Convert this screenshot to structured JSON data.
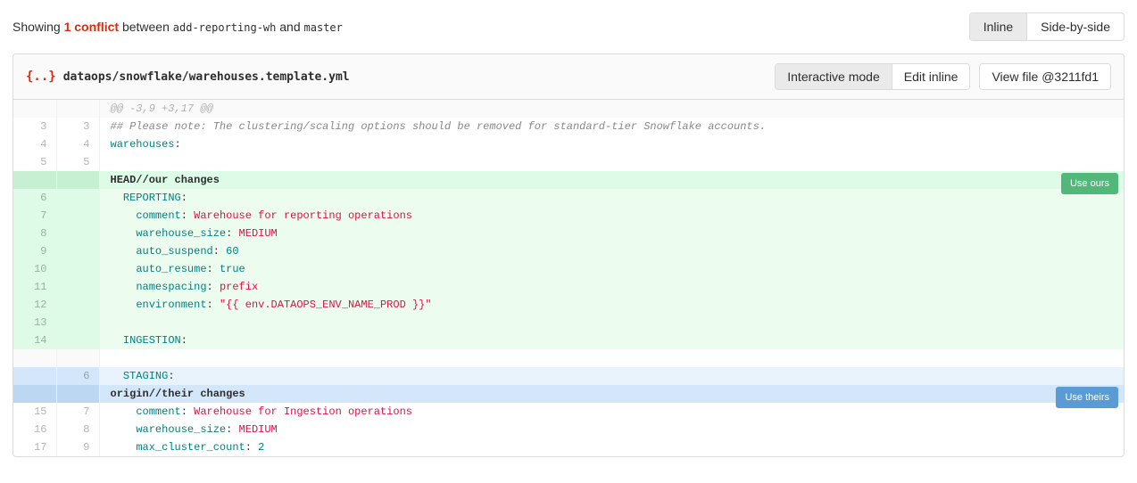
{
  "header": {
    "prefix": "Showing ",
    "conflict_count": "1 conflict",
    "between": " between ",
    "source_branch": "add-reporting-wh",
    "and": " and ",
    "target_branch": "master"
  },
  "view_toggle": {
    "inline": "Inline",
    "sidebyside": "Side-by-side"
  },
  "file": {
    "icon": "{..}",
    "path": "dataops/snowflake/warehouses.template.yml",
    "actions": {
      "interactive": "Interactive mode",
      "edit_inline": "Edit inline",
      "view_file": "View file @3211fd1"
    }
  },
  "diff": {
    "hunk": "@@ -3,9 +3,17 @@",
    "rows": [
      {
        "old": "3",
        "new": "3",
        "kind": "context",
        "segments": [
          {
            "cls": "syn-comment",
            "t": "## Please note: The clustering/scaling options should be removed for standard-tier Snowflake accounts."
          }
        ]
      },
      {
        "old": "4",
        "new": "4",
        "kind": "context",
        "segments": [
          {
            "cls": "syn-key",
            "t": "warehouses"
          },
          {
            "cls": "",
            "t": ":"
          }
        ]
      },
      {
        "old": "5",
        "new": "5",
        "kind": "context",
        "segments": []
      },
      {
        "old": "",
        "new": "",
        "kind": "head-marker",
        "badge": "Use ours",
        "segments": [
          {
            "cls": "",
            "t": "HEAD//our changes"
          }
        ]
      },
      {
        "old": "6",
        "new": "",
        "kind": "ours",
        "indent": "  ",
        "segments": [
          {
            "cls": "syn-key",
            "t": "REPORTING"
          },
          {
            "cls": "",
            "t": ":"
          }
        ]
      },
      {
        "old": "7",
        "new": "",
        "kind": "ours",
        "indent": "    ",
        "segments": [
          {
            "cls": "syn-key",
            "t": "comment"
          },
          {
            "cls": "",
            "t": ": "
          },
          {
            "cls": "syn-string",
            "t": "Warehouse for reporting operations"
          }
        ]
      },
      {
        "old": "8",
        "new": "",
        "kind": "ours",
        "indent": "    ",
        "segments": [
          {
            "cls": "syn-key",
            "t": "warehouse_size"
          },
          {
            "cls": "",
            "t": ": "
          },
          {
            "cls": "syn-string",
            "t": "MEDIUM"
          }
        ]
      },
      {
        "old": "9",
        "new": "",
        "kind": "ours",
        "indent": "    ",
        "segments": [
          {
            "cls": "syn-key",
            "t": "auto_suspend"
          },
          {
            "cls": "",
            "t": ": "
          },
          {
            "cls": "syn-num",
            "t": "60"
          }
        ]
      },
      {
        "old": "10",
        "new": "",
        "kind": "ours",
        "indent": "    ",
        "segments": [
          {
            "cls": "syn-key",
            "t": "auto_resume"
          },
          {
            "cls": "",
            "t": ": "
          },
          {
            "cls": "syn-bool",
            "t": "true"
          }
        ]
      },
      {
        "old": "11",
        "new": "",
        "kind": "ours",
        "indent": "    ",
        "segments": [
          {
            "cls": "syn-key",
            "t": "namespacing"
          },
          {
            "cls": "",
            "t": ": "
          },
          {
            "cls": "syn-string",
            "t": "prefix"
          }
        ]
      },
      {
        "old": "12",
        "new": "",
        "kind": "ours",
        "indent": "    ",
        "segments": [
          {
            "cls": "syn-key",
            "t": "environment"
          },
          {
            "cls": "",
            "t": ": "
          },
          {
            "cls": "syn-string",
            "t": "\"{{ env.DATAOPS_ENV_NAME_PROD }}\""
          }
        ]
      },
      {
        "old": "13",
        "new": "",
        "kind": "ours",
        "indent": "",
        "segments": []
      },
      {
        "old": "14",
        "new": "",
        "kind": "ours",
        "indent": "  ",
        "segments": [
          {
            "cls": "syn-key",
            "t": "INGESTION"
          },
          {
            "cls": "",
            "t": ":"
          }
        ]
      },
      {
        "old": "",
        "new": "",
        "kind": "spacer",
        "segments": []
      },
      {
        "old": "",
        "new": "6",
        "kind": "theirs",
        "indent": "  ",
        "segments": [
          {
            "cls": "syn-key",
            "t": "STAGING"
          },
          {
            "cls": "",
            "t": ":"
          }
        ]
      },
      {
        "old": "",
        "new": "",
        "kind": "origin-marker",
        "badge": "Use theirs",
        "segments": [
          {
            "cls": "",
            "t": "origin//their changes"
          }
        ]
      },
      {
        "old": "15",
        "new": "7",
        "kind": "common",
        "indent": "    ",
        "segments": [
          {
            "cls": "syn-key",
            "t": "comment"
          },
          {
            "cls": "",
            "t": ": "
          },
          {
            "cls": "syn-string",
            "t": "Warehouse for Ingestion operations"
          }
        ]
      },
      {
        "old": "16",
        "new": "8",
        "kind": "common",
        "indent": "    ",
        "segments": [
          {
            "cls": "syn-key",
            "t": "warehouse_size"
          },
          {
            "cls": "",
            "t": ": "
          },
          {
            "cls": "syn-string",
            "t": "MEDIUM"
          }
        ]
      },
      {
        "old": "17",
        "new": "9",
        "kind": "common",
        "indent": "    ",
        "segments": [
          {
            "cls": "syn-key",
            "t": "max_cluster_count"
          },
          {
            "cls": "",
            "t": ": "
          },
          {
            "cls": "syn-num",
            "t": "2"
          }
        ]
      }
    ],
    "badge_ours": "Use ours",
    "badge_theirs": "Use theirs"
  }
}
